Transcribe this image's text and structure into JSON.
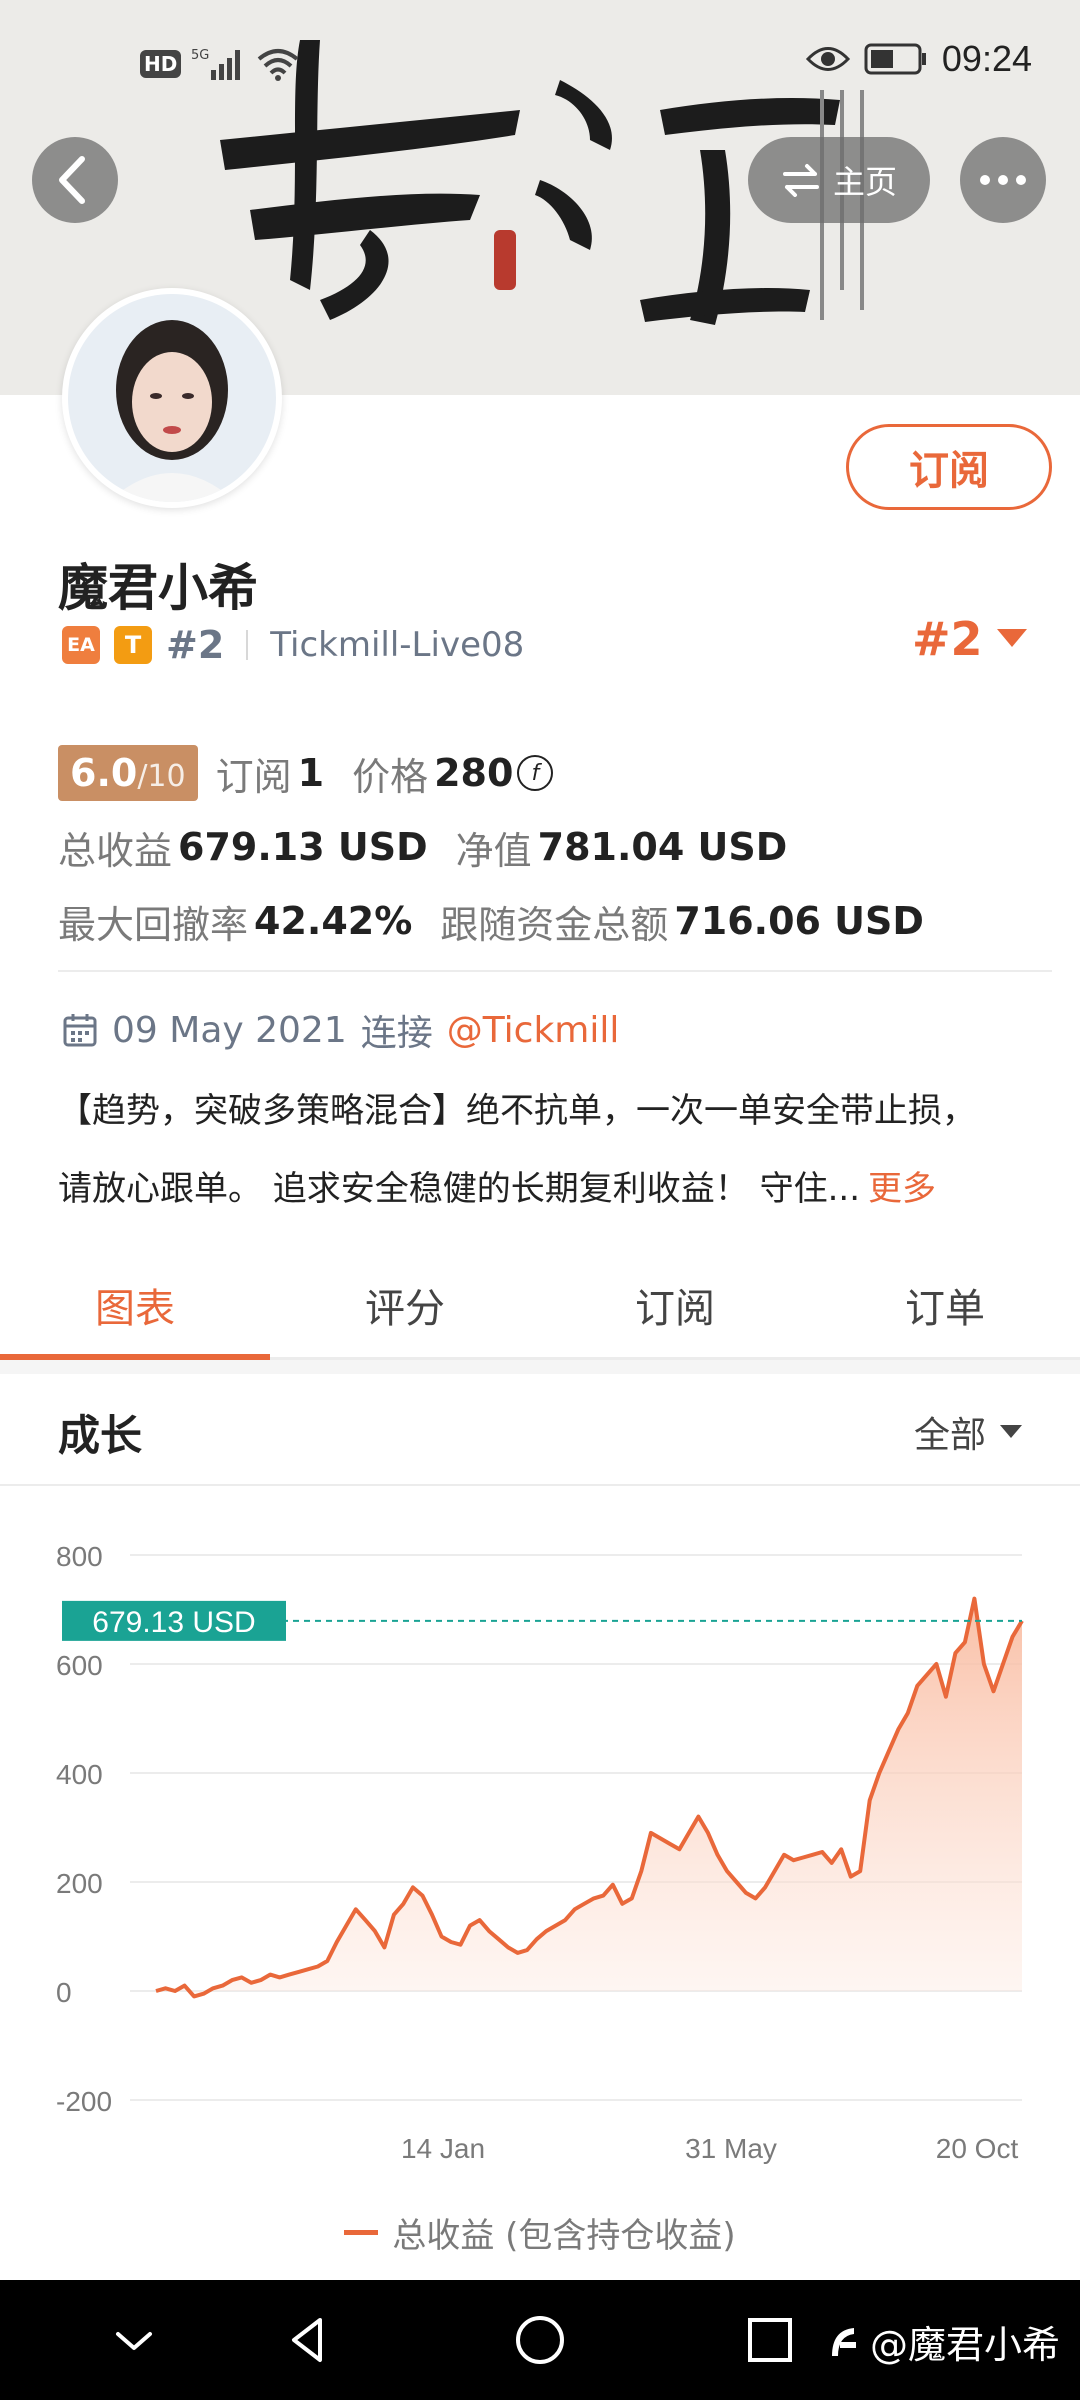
{
  "status_bar": {
    "hd": "HD",
    "network": "5G",
    "time": "09:24"
  },
  "banner": {
    "home_label": "主页",
    "artwork_calligraphy": "专注"
  },
  "profile": {
    "name": "魔君小希",
    "badge_ea": "EA",
    "badge_t": "T",
    "rank": "#2",
    "server": "Tickmill-Live08",
    "rank_right": "#2",
    "subscribe_label": "订阅"
  },
  "stats": {
    "score": "6.0",
    "score_max": "/10",
    "subscribe_label": "订阅",
    "subscribe_count": "1",
    "price_label": "价格",
    "price_value": "280",
    "total_profit_label": "总收益",
    "total_profit_value": "679.13 USD",
    "net_value_label": "净值",
    "net_value_value": "781.04 USD",
    "max_drawdown_label": "最大回撤率",
    "max_drawdown_value": "42.42%",
    "follow_funds_label": "跟随资金总额",
    "follow_funds_value": "716.06 USD"
  },
  "meta": {
    "date": "09 May 2021",
    "connect_label": "连接",
    "broker_link": "@Tickmill"
  },
  "description": {
    "line1": "【趋势，突破多策略混合】绝不抗单，一次一单安全带止损，",
    "line2": "请放心跟单。 追求安全稳健的长期复利收益！ 守住...",
    "more": "更多"
  },
  "tabs": [
    "图表",
    "评分",
    "订阅",
    "订单"
  ],
  "chart_section": {
    "title": "成长",
    "range": "全部"
  },
  "chart_data": {
    "type": "area",
    "ylim": [
      -200,
      800
    ],
    "yticks": [
      "800",
      "600",
      "400",
      "200",
      "0",
      "-200"
    ],
    "ytick_values": [
      800,
      600,
      400,
      200,
      0,
      -200
    ],
    "xticks": [
      "14 Jan",
      "31 May",
      "20 Oct"
    ],
    "current_label": "679.13 USD",
    "current_value": 679.13,
    "series": [
      {
        "name": "总收益 (包含持仓收益)",
        "values": [
          0,
          5,
          0,
          10,
          -10,
          -5,
          5,
          10,
          20,
          25,
          15,
          20,
          30,
          25,
          30,
          35,
          40,
          45,
          55,
          90,
          120,
          150,
          130,
          110,
          80,
          140,
          160,
          190,
          175,
          140,
          100,
          90,
          85,
          120,
          130,
          110,
          95,
          80,
          70,
          75,
          95,
          110,
          120,
          130,
          150,
          160,
          170,
          175,
          195,
          160,
          170,
          220,
          290,
          280,
          270,
          260,
          290,
          320,
          290,
          250,
          220,
          200,
          180,
          170,
          190,
          220,
          250,
          240,
          245,
          250,
          255,
          235,
          260,
          210,
          220,
          350,
          400,
          440,
          480,
          510,
          560,
          580,
          600,
          540,
          620,
          640,
          720,
          600,
          550,
          600,
          650,
          679.13
        ]
      }
    ],
    "colors": {
      "line": "#e9683a",
      "area_top": "#f9c6b0",
      "current_line": "#1aa394"
    },
    "grid": true
  },
  "legend": {
    "label": "总收益 (包含持仓收益)"
  },
  "navbar": {
    "watermark": "@魔君小希"
  }
}
